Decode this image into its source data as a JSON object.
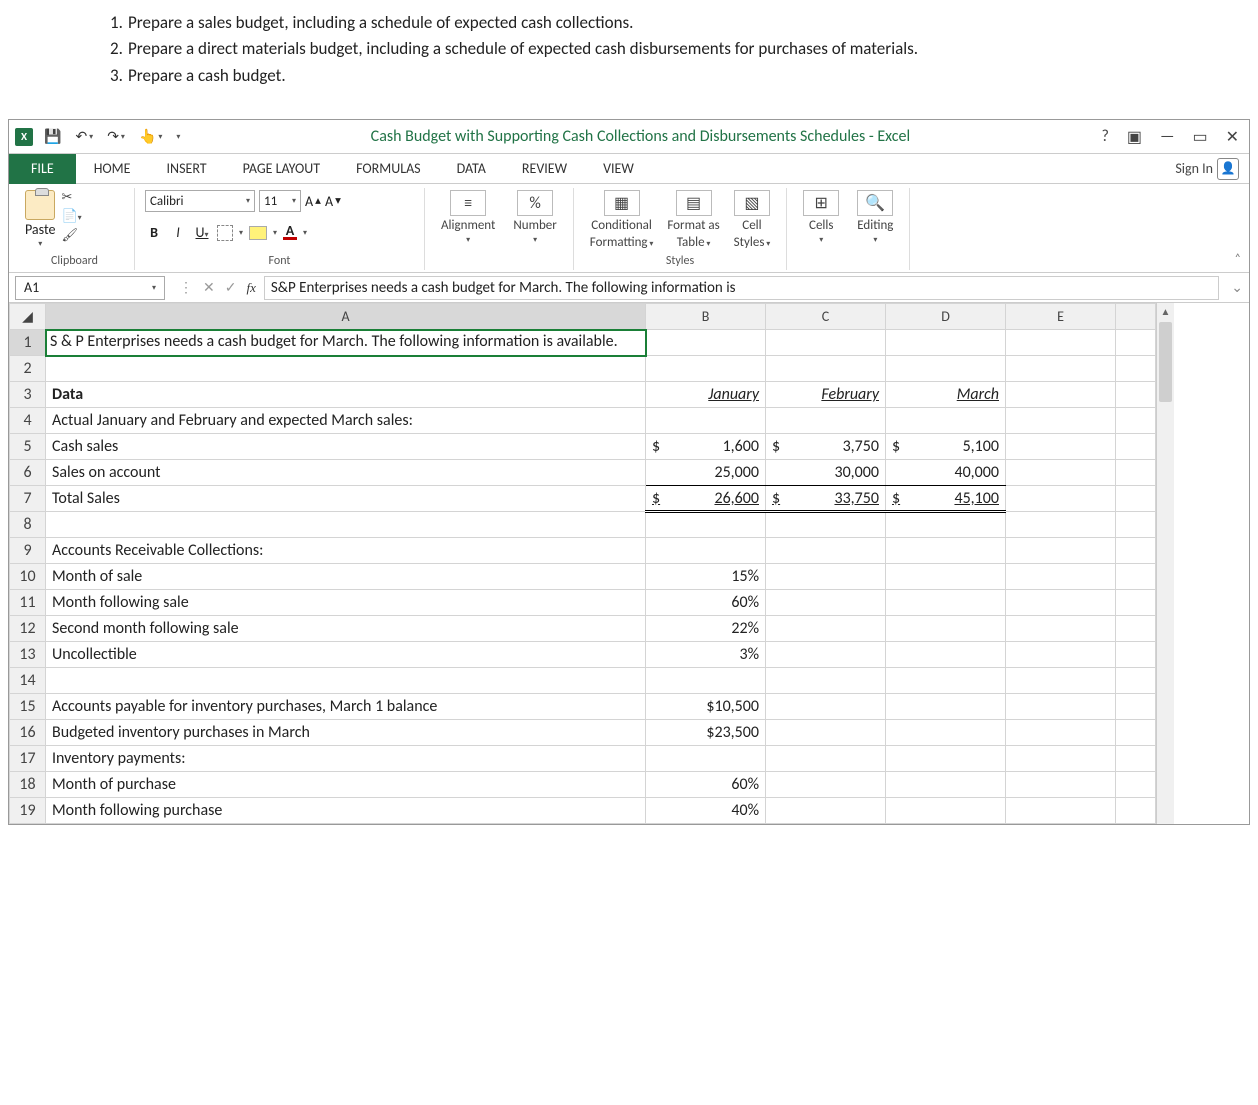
{
  "instructions": {
    "item1": "Prepare a sales budget, including a schedule of expected cash collections.",
    "item2": "Prepare a direct materials budget, including a schedule of expected cash disbursements for purchases of materials.",
    "item3": "Prepare a cash budget."
  },
  "title": "Cash Budget with Supporting Cash Collections and Disbursements Schedules - Excel",
  "tabs": {
    "file": "FILE",
    "home": "HOME",
    "insert": "INSERT",
    "pagelayout": "PAGE LAYOUT",
    "formulas": "FORMULAS",
    "data": "DATA",
    "review": "REVIEW",
    "view": "VIEW",
    "signin": "Sign In"
  },
  "ribbon": {
    "paste": "Paste",
    "clipboard": "Clipboard",
    "fontname": "Calibri",
    "fontsize": "11",
    "font": "Font",
    "alignment": "Alignment",
    "number": "Number",
    "condfmt1": "Conditional",
    "condfmt2": "Formatting",
    "fmttable1": "Format as",
    "fmttable2": "Table",
    "cellstyles1": "Cell",
    "cellstyles2": "Styles",
    "styles": "Styles",
    "cells": "Cells",
    "editing": "Editing"
  },
  "namebox": "A1",
  "formula": "S&P Enterprises needs a cash budget for March. The following information is",
  "cols": {
    "A": "A",
    "B": "B",
    "C": "C",
    "D": "D",
    "E": "E"
  },
  "rows": {
    "r1A": "S & P Enterprises needs a cash budget for March. The following information is available.",
    "r3A": "Data",
    "r3B": "January",
    "r3C": "February",
    "r3D": "March",
    "r4A": "Actual January and February and expected March sales:",
    "r5A": "Cash sales",
    "r5Bd": "$",
    "r5Bv": "1,600",
    "r5Cd": "$",
    "r5Cv": "3,750",
    "r5Dd": "$",
    "r5Dv": "5,100",
    "r6A": "Sales on account",
    "r6B": "25,000",
    "r6C": "30,000",
    "r6D": "40,000",
    "r7A": "Total Sales",
    "r7Bd": "$",
    "r7Bv": "26,600",
    "r7Cd": "$",
    "r7Cv": "33,750",
    "r7Dd": "$",
    "r7Dv": "45,100",
    "r9A": "Accounts Receivable Collections:",
    "r10A": "Month of sale",
    "r10B": "15%",
    "r11A": "Month following sale",
    "r11B": "60%",
    "r12A": "Second month following sale",
    "r12B": "22%",
    "r13A": "Uncollectible",
    "r13B": "3%",
    "r15A": "Accounts payable for inventory purchases, March 1 balance",
    "r15B": "$10,500",
    "r16A": "Budgeted inventory purchases in March",
    "r16B": "$23,500",
    "r17A": "Inventory payments:",
    "r18A": "Month of purchase",
    "r18B": "60%",
    "r19A": "Month following purchase",
    "r19B": "40%"
  }
}
